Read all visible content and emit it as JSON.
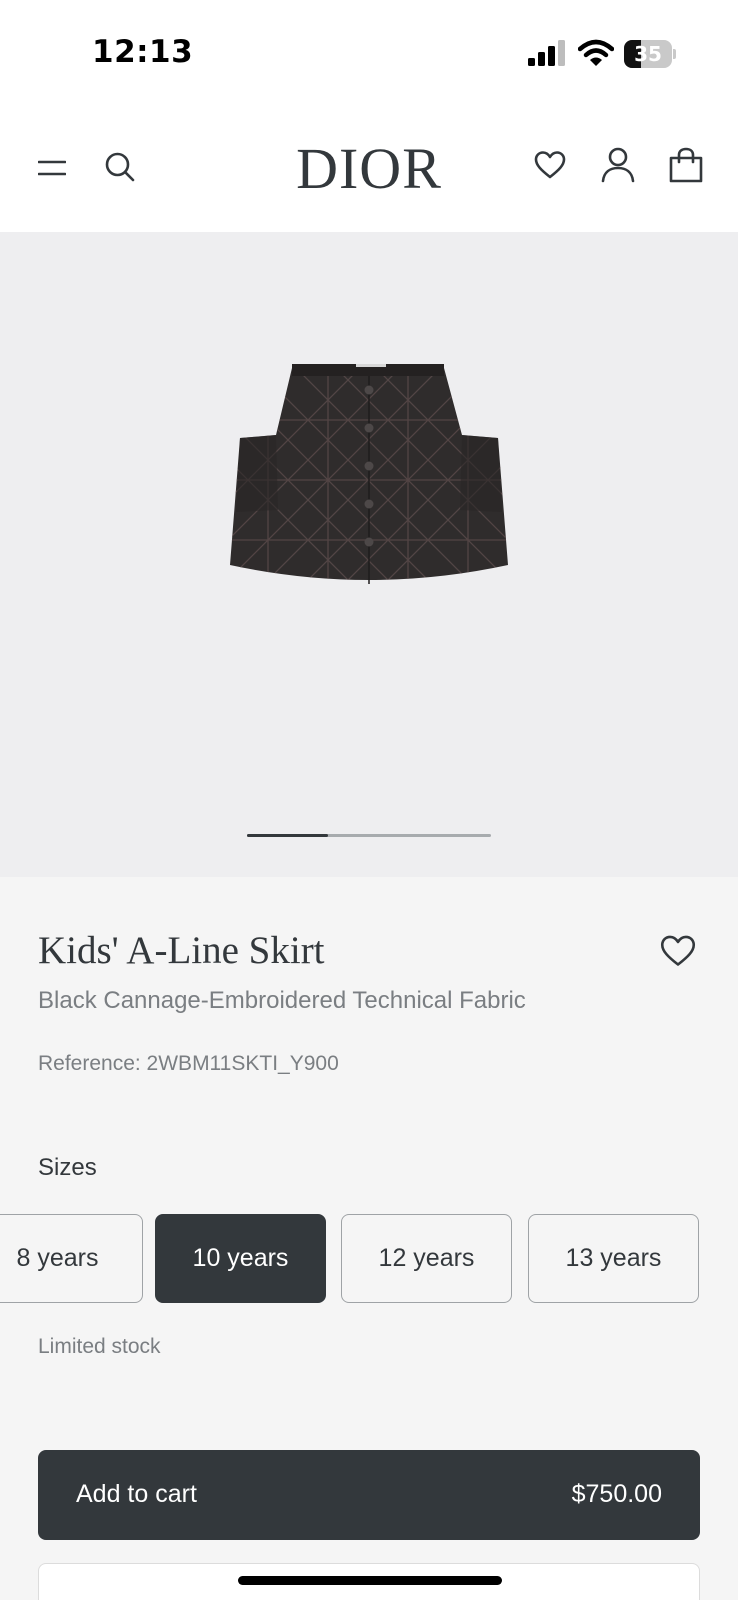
{
  "status_bar": {
    "time": "12:13",
    "battery_level": "35",
    "icons": [
      "signal-icon",
      "wifi-icon",
      "battery-icon"
    ]
  },
  "header": {
    "logo": "DIOR",
    "icons": [
      "menu-icon",
      "search-icon",
      "heart-icon",
      "account-icon",
      "bag-icon"
    ]
  },
  "gallery": {
    "image": "black quilted skirt",
    "current_image_fraction": 0.33
  },
  "product": {
    "name": "Kids' A-Line Skirt",
    "description": "Black Cannage-Embroidered Technical Fabric",
    "reference": "Reference: 2WBM11SKTI_Y900"
  },
  "sizes": {
    "label": "Sizes",
    "options": [
      {
        "label": "8 years",
        "selected": false
      },
      {
        "label": "10 years",
        "selected": true
      },
      {
        "label": "12 years",
        "selected": false
      },
      {
        "label": "13 years",
        "selected": false
      }
    ],
    "stock": "Limited stock"
  },
  "cart": {
    "label": "Add to cart",
    "price": "$750.00"
  },
  "colors": {
    "primary": "#33383c",
    "muted_text": "#7a7e82",
    "page_background": "#f5f5f5",
    "gallery_background": "#eeeef0"
  }
}
